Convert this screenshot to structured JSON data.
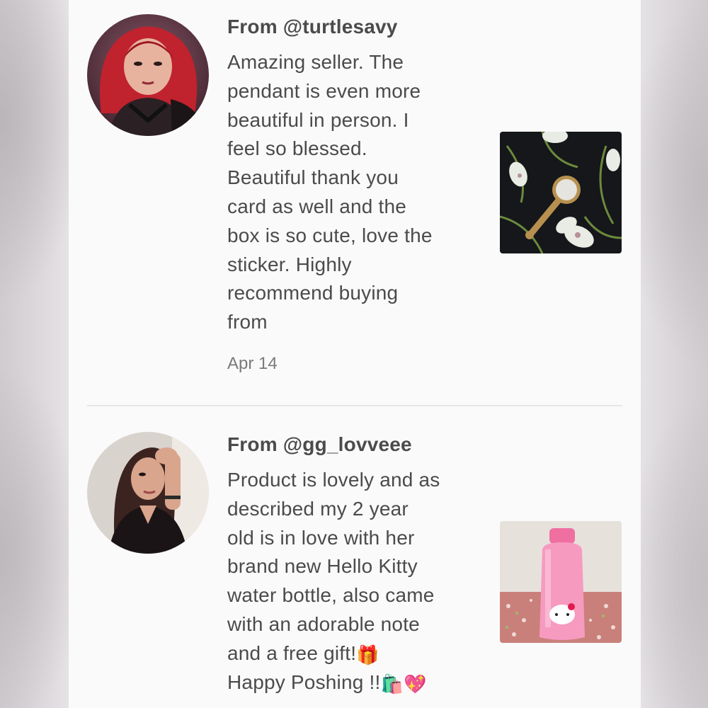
{
  "reviews": [
    {
      "from": "From @turtlesavy",
      "comment": "Amazing seller. The\npendant is even more\nbeautiful in person. I\nfeel so blessed.\nBeautiful thank you\ncard as well and the\nbox is so cute, love the\nsticker. Highly\nrecommend buying\nfrom",
      "date": "Apr 14"
    },
    {
      "from": "From @gg_lovveee",
      "comment": "Product is lovely and as\ndescribed my 2 year\nold is in love with her\nbrand new Hello Kitty\nwater bottle, also came\nwith an adorable note\nand a free gift!",
      "comment_tail": "Happy Poshing !!",
      "emojis": [
        "🎁",
        "🛍️",
        "💖"
      ]
    }
  ],
  "icons": {
    "r1_avatar": "user-avatar-red-hair",
    "r1_thumb": "mirror-pendant-photo",
    "r2_avatar": "user-avatar-brunette",
    "r2_thumb": "hello-kitty-bottle-photo"
  }
}
